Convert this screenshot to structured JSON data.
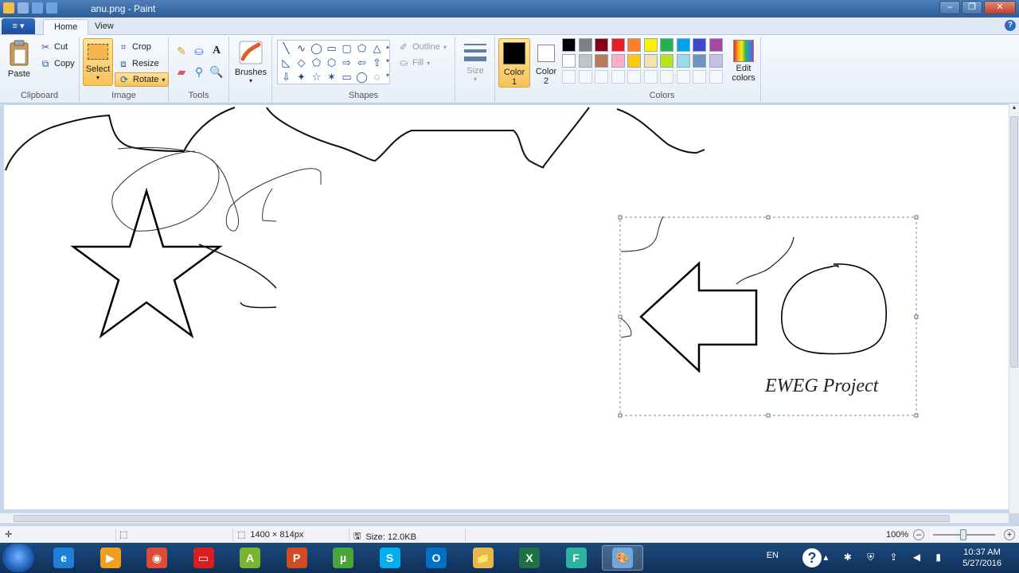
{
  "window": {
    "title": "anu.png - Paint"
  },
  "ribbon_tabs": {
    "file": "≡ ▾",
    "home": "Home",
    "view": "View"
  },
  "clipboard": {
    "paste": "Paste",
    "cut": "Cut",
    "copy": "Copy",
    "label": "Clipboard"
  },
  "image": {
    "select": "Select",
    "crop": "Crop",
    "resize": "Resize",
    "rotate": "Rotate",
    "label": "Image"
  },
  "tools": {
    "label": "Tools",
    "text_tool": "A"
  },
  "brushes": {
    "label": "Brushes"
  },
  "shapes": {
    "label": "Shapes",
    "outline": "Outline",
    "fill": "Fill",
    "glyphs": [
      "╲",
      "∿",
      "◯",
      "▭",
      "▢",
      "⬠",
      "△",
      "◺",
      "◇",
      "⬠",
      "⬡",
      "⇨",
      "⇦",
      "⇧",
      "⇩",
      "✦",
      "☆",
      "✶",
      "▭",
      "◯",
      "◌"
    ]
  },
  "size": {
    "label": "Size"
  },
  "color1": {
    "label_line1": "Color",
    "label_line2": "1",
    "value": "#000000"
  },
  "color2": {
    "label_line1": "Color",
    "label_line2": "2",
    "value": "#ffffff"
  },
  "colors": {
    "label": "Colors",
    "edit_line1": "Edit",
    "edit_line2": "colors",
    "palette_row1": [
      "#000000",
      "#7f7f7f",
      "#880015",
      "#ed1c24",
      "#ff7f27",
      "#fff200",
      "#22b14c",
      "#00a2e8",
      "#3f48cc",
      "#a349a4"
    ],
    "palette_row2": [
      "#ffffff",
      "#c3c3c3",
      "#b97a57",
      "#ffaec9",
      "#ffc90e",
      "#efe4b0",
      "#b5e61d",
      "#99d9ea",
      "#7092be",
      "#c8bfe7"
    ]
  },
  "canvas": {
    "text_label": "EWEG Project"
  },
  "status": {
    "dimensions": "1400 × 814px",
    "size": "Size: 12.0KB",
    "zoom": "100%"
  },
  "taskbar": {
    "apps": [
      "e",
      "▶",
      "◉",
      "▭",
      "A",
      "P",
      "µ",
      "S",
      "O",
      "📁",
      "X",
      "F",
      "🎨"
    ],
    "app_colors": [
      "#1e7fd6",
      "#f0a020",
      "#dd4b39",
      "#d81e1e",
      "#7ab52d",
      "#d04a23",
      "#4ba33b",
      "#00aff0",
      "#0072c6",
      "#e8b84a",
      "#1e7145",
      "#2bb3a0",
      "#6fa8dc"
    ],
    "lang": "EN",
    "time": "10:37 AM",
    "date": "5/27/2016"
  }
}
